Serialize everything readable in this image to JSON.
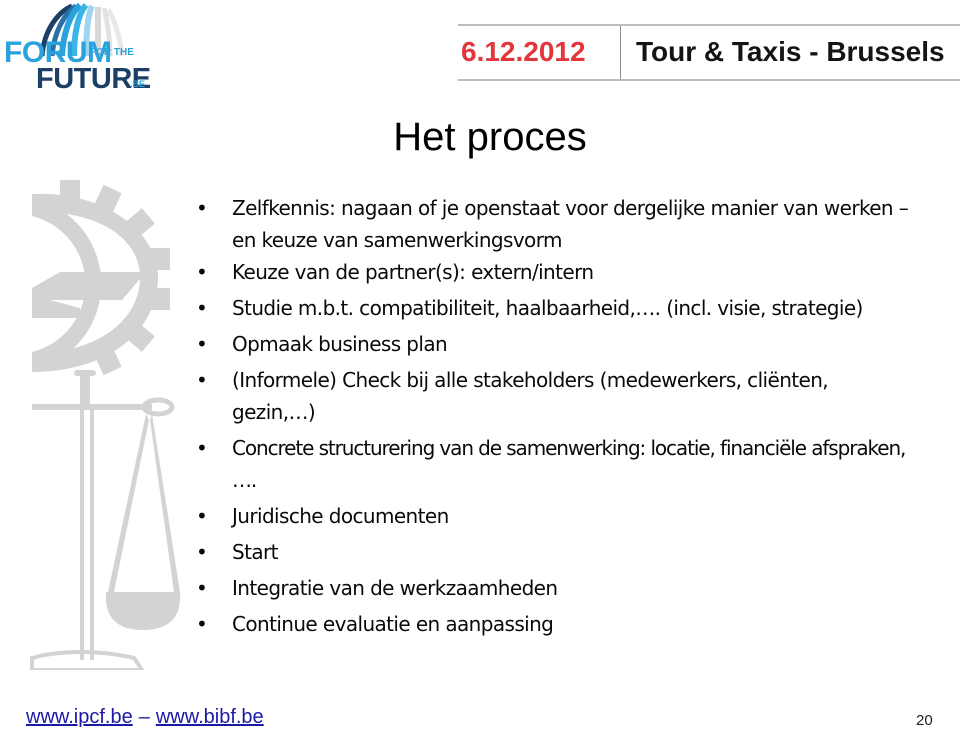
{
  "logo": {
    "line1": "FORUM",
    "line1_small": "FOR THE",
    "line2": "FUTURE",
    "line2_suffix": ".BE",
    "colors": {
      "light_blue": "#2aa3dc",
      "dark_blue": "#1b3f66"
    }
  },
  "event": {
    "date": "6.12.2012",
    "place": "Tour & Taxis - Brussels",
    "date_color": "#e2353c"
  },
  "watermark": {
    "icon": "gear-and-scale-icon",
    "color": "#d3d3d3"
  },
  "slide": {
    "title": "Het proces",
    "bullets": [
      {
        "text": "Zelfkennis: nagaan of je openstaat voor dergelijke manier van werken – en keuze van samenwerkingsvorm"
      },
      {
        "text": "Keuze van de partner(s): extern/intern"
      },
      {
        "text": "Studie m.b.t. compatibiliteit, haalbaarheid,…. (incl. visie, strategie)"
      },
      {
        "text": "Opmaak business plan"
      },
      {
        "text": "(Informele) Check bij alle stakeholders (medewerkers, cliënten, gezin,…)"
      },
      {
        "text": "Concrete structurering van de samenwerking: locatie, financiële afspraken, …."
      },
      {
        "text": "Juridische documenten"
      },
      {
        "text": "Start"
      },
      {
        "text": "Integratie van de werkzaamheden"
      },
      {
        "text": "Continue evaluatie en aanpassing"
      }
    ],
    "bullet_glyph": "•"
  },
  "footer": {
    "link1": "www.ipcf.be",
    "separator": "–",
    "link2": "www.bibf.be",
    "page_number": "20"
  }
}
